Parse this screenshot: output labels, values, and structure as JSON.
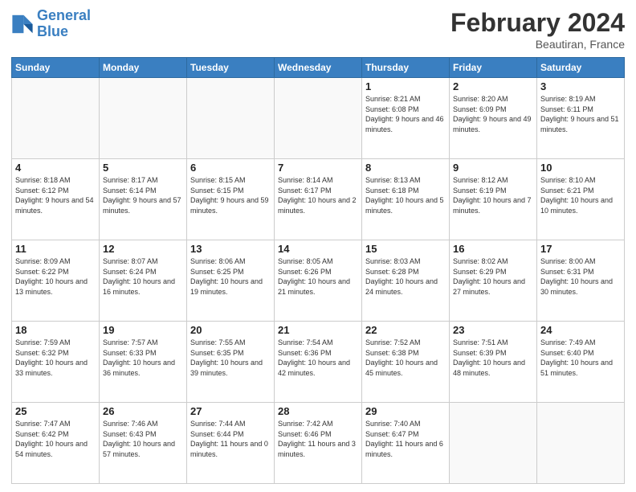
{
  "header": {
    "logo_text_general": "General",
    "logo_text_blue": "Blue",
    "month_title": "February 2024",
    "location": "Beautiran, France"
  },
  "days_of_week": [
    "Sunday",
    "Monday",
    "Tuesday",
    "Wednesday",
    "Thursday",
    "Friday",
    "Saturday"
  ],
  "weeks": [
    [
      {
        "day": "",
        "info": ""
      },
      {
        "day": "",
        "info": ""
      },
      {
        "day": "",
        "info": ""
      },
      {
        "day": "",
        "info": ""
      },
      {
        "day": "1",
        "info": "Sunrise: 8:21 AM\nSunset: 6:08 PM\nDaylight: 9 hours\nand 46 minutes."
      },
      {
        "day": "2",
        "info": "Sunrise: 8:20 AM\nSunset: 6:09 PM\nDaylight: 9 hours\nand 49 minutes."
      },
      {
        "day": "3",
        "info": "Sunrise: 8:19 AM\nSunset: 6:11 PM\nDaylight: 9 hours\nand 51 minutes."
      }
    ],
    [
      {
        "day": "4",
        "info": "Sunrise: 8:18 AM\nSunset: 6:12 PM\nDaylight: 9 hours\nand 54 minutes."
      },
      {
        "day": "5",
        "info": "Sunrise: 8:17 AM\nSunset: 6:14 PM\nDaylight: 9 hours\nand 57 minutes."
      },
      {
        "day": "6",
        "info": "Sunrise: 8:15 AM\nSunset: 6:15 PM\nDaylight: 9 hours\nand 59 minutes."
      },
      {
        "day": "7",
        "info": "Sunrise: 8:14 AM\nSunset: 6:17 PM\nDaylight: 10 hours\nand 2 minutes."
      },
      {
        "day": "8",
        "info": "Sunrise: 8:13 AM\nSunset: 6:18 PM\nDaylight: 10 hours\nand 5 minutes."
      },
      {
        "day": "9",
        "info": "Sunrise: 8:12 AM\nSunset: 6:19 PM\nDaylight: 10 hours\nand 7 minutes."
      },
      {
        "day": "10",
        "info": "Sunrise: 8:10 AM\nSunset: 6:21 PM\nDaylight: 10 hours\nand 10 minutes."
      }
    ],
    [
      {
        "day": "11",
        "info": "Sunrise: 8:09 AM\nSunset: 6:22 PM\nDaylight: 10 hours\nand 13 minutes."
      },
      {
        "day": "12",
        "info": "Sunrise: 8:07 AM\nSunset: 6:24 PM\nDaylight: 10 hours\nand 16 minutes."
      },
      {
        "day": "13",
        "info": "Sunrise: 8:06 AM\nSunset: 6:25 PM\nDaylight: 10 hours\nand 19 minutes."
      },
      {
        "day": "14",
        "info": "Sunrise: 8:05 AM\nSunset: 6:26 PM\nDaylight: 10 hours\nand 21 minutes."
      },
      {
        "day": "15",
        "info": "Sunrise: 8:03 AM\nSunset: 6:28 PM\nDaylight: 10 hours\nand 24 minutes."
      },
      {
        "day": "16",
        "info": "Sunrise: 8:02 AM\nSunset: 6:29 PM\nDaylight: 10 hours\nand 27 minutes."
      },
      {
        "day": "17",
        "info": "Sunrise: 8:00 AM\nSunset: 6:31 PM\nDaylight: 10 hours\nand 30 minutes."
      }
    ],
    [
      {
        "day": "18",
        "info": "Sunrise: 7:59 AM\nSunset: 6:32 PM\nDaylight: 10 hours\nand 33 minutes."
      },
      {
        "day": "19",
        "info": "Sunrise: 7:57 AM\nSunset: 6:33 PM\nDaylight: 10 hours\nand 36 minutes."
      },
      {
        "day": "20",
        "info": "Sunrise: 7:55 AM\nSunset: 6:35 PM\nDaylight: 10 hours\nand 39 minutes."
      },
      {
        "day": "21",
        "info": "Sunrise: 7:54 AM\nSunset: 6:36 PM\nDaylight: 10 hours\nand 42 minutes."
      },
      {
        "day": "22",
        "info": "Sunrise: 7:52 AM\nSunset: 6:38 PM\nDaylight: 10 hours\nand 45 minutes."
      },
      {
        "day": "23",
        "info": "Sunrise: 7:51 AM\nSunset: 6:39 PM\nDaylight: 10 hours\nand 48 minutes."
      },
      {
        "day": "24",
        "info": "Sunrise: 7:49 AM\nSunset: 6:40 PM\nDaylight: 10 hours\nand 51 minutes."
      }
    ],
    [
      {
        "day": "25",
        "info": "Sunrise: 7:47 AM\nSunset: 6:42 PM\nDaylight: 10 hours\nand 54 minutes."
      },
      {
        "day": "26",
        "info": "Sunrise: 7:46 AM\nSunset: 6:43 PM\nDaylight: 10 hours\nand 57 minutes."
      },
      {
        "day": "27",
        "info": "Sunrise: 7:44 AM\nSunset: 6:44 PM\nDaylight: 11 hours\nand 0 minutes."
      },
      {
        "day": "28",
        "info": "Sunrise: 7:42 AM\nSunset: 6:46 PM\nDaylight: 11 hours\nand 3 minutes."
      },
      {
        "day": "29",
        "info": "Sunrise: 7:40 AM\nSunset: 6:47 PM\nDaylight: 11 hours\nand 6 minutes."
      },
      {
        "day": "",
        "info": ""
      },
      {
        "day": "",
        "info": ""
      }
    ]
  ]
}
